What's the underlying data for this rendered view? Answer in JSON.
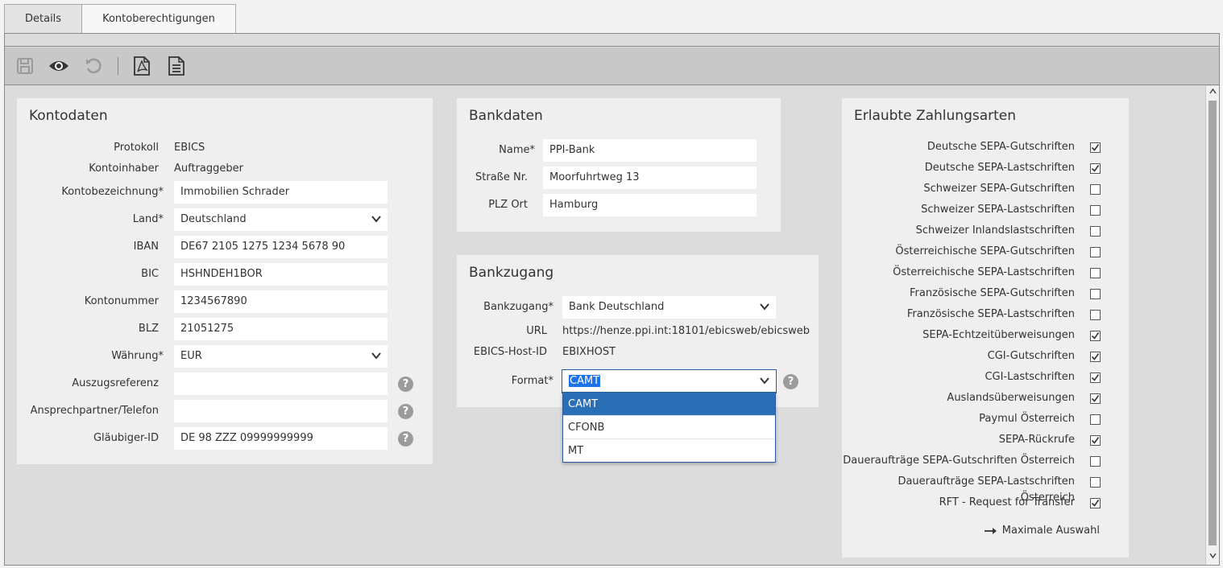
{
  "tabs": [
    {
      "label": "Details"
    },
    {
      "label": "Kontoberechtigungen"
    }
  ],
  "toolbar": {
    "icons": [
      "save-icon",
      "eye-icon",
      "undo-icon",
      "pdf-icon",
      "document-icon"
    ]
  },
  "kontodaten": {
    "title": "Kontodaten",
    "protokoll_label": "Protokoll",
    "protokoll_value": "EBICS",
    "kontoinhaber_label": "Kontoinhaber",
    "kontoinhaber_value": "Auftraggeber",
    "kontobezeichnung_label": "Kontobezeichnung*",
    "kontobezeichnung_value": "Immobilien Schrader",
    "land_label": "Land*",
    "land_value": "Deutschland",
    "iban_label": "IBAN",
    "iban_value": "DE67 2105 1275 1234 5678 90",
    "bic_label": "BIC",
    "bic_value": "HSHNDEH1BOR",
    "kontonummer_label": "Kontonummer",
    "kontonummer_value": "1234567890",
    "blz_label": "BLZ",
    "blz_value": "21051275",
    "waehrung_label": "Währung*",
    "waehrung_value": "EUR",
    "auszugsreferenz_label": "Auszugsreferenz",
    "auszugsreferenz_value": "",
    "ansprechpartner_label": "Ansprechpartner/Telefon",
    "ansprechpartner_value": "",
    "glaeubiger_label": "Gläubiger-ID",
    "glaeubiger_value": "DE 98 ZZZ 09999999999"
  },
  "bankdaten": {
    "title": "Bankdaten",
    "name_label": "Name*",
    "name_value": "PPI-Bank",
    "strasse_label": "Straße Nr.",
    "strasse_value": "Moorfuhrtweg 13",
    "plz_label": "PLZ Ort",
    "plz_value": "Hamburg"
  },
  "bankzugang": {
    "title": "Bankzugang",
    "bankzugang_label": "Bankzugang*",
    "bankzugang_value": "Bank Deutschland",
    "url_label": "URL",
    "url_value": "https://henze.ppi.int:18101/ebicsweb/ebicsweb",
    "hostid_label": "EBICS-Host-ID",
    "hostid_value": "EBIXHOST",
    "format_label": "Format*",
    "format_value": "CAMT",
    "format_options": [
      "CAMT",
      "CFONB",
      "MT"
    ]
  },
  "zahlungsarten": {
    "title": "Erlaubte Zahlungsarten",
    "items": [
      {
        "label": "Deutsche SEPA-Gutschriften",
        "checked": true
      },
      {
        "label": "Deutsche SEPA-Lastschriften",
        "checked": true
      },
      {
        "label": "Schweizer SEPA-Gutschriften",
        "checked": false
      },
      {
        "label": "Schweizer SEPA-Lastschriften",
        "checked": false
      },
      {
        "label": "Schweizer Inlandslastschriften",
        "checked": false
      },
      {
        "label": "Österreichische SEPA-Gutschriften",
        "checked": false
      },
      {
        "label": "Österreichische SEPA-Lastschriften",
        "checked": false
      },
      {
        "label": "Französische SEPA-Gutschriften",
        "checked": false
      },
      {
        "label": "Französische SEPA-Lastschriften",
        "checked": false
      },
      {
        "label": "SEPA-Echtzeitüberweisungen",
        "checked": true
      },
      {
        "label": "CGI-Gutschriften",
        "checked": true
      },
      {
        "label": "CGI-Lastschriften",
        "checked": true
      },
      {
        "label": "Auslandsüberweisungen",
        "checked": true
      },
      {
        "label": "Paymul Österreich",
        "checked": false
      },
      {
        "label": "SEPA-Rückrufe",
        "checked": true
      },
      {
        "label": "Daueraufträge SEPA-Gutschriften Österreich",
        "checked": false
      },
      {
        "label": "Daueraufträge SEPA-Lastschriften Österreich",
        "checked": false
      },
      {
        "label": "RFT - Request for Transfer",
        "checked": true
      }
    ],
    "max_label": "Maximale Auswahl"
  },
  "help_glyph": "?"
}
